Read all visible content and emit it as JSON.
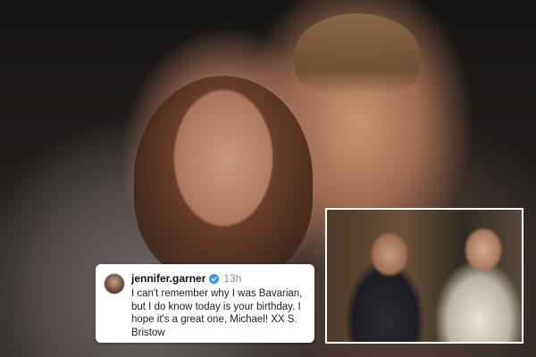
{
  "post": {
    "username": "jennifer.garner",
    "verified_icon": "verified-badge-icon",
    "timestamp": "13h",
    "caption": "I can't remember why I was Bavarian, but I do know today is your birthday. I hope it's a great one, Michael! XX S. Bristow"
  },
  "colors": {
    "verified_badge": "#3897f0",
    "card_background": "#ffffff",
    "inset_border": "#ffffff"
  }
}
